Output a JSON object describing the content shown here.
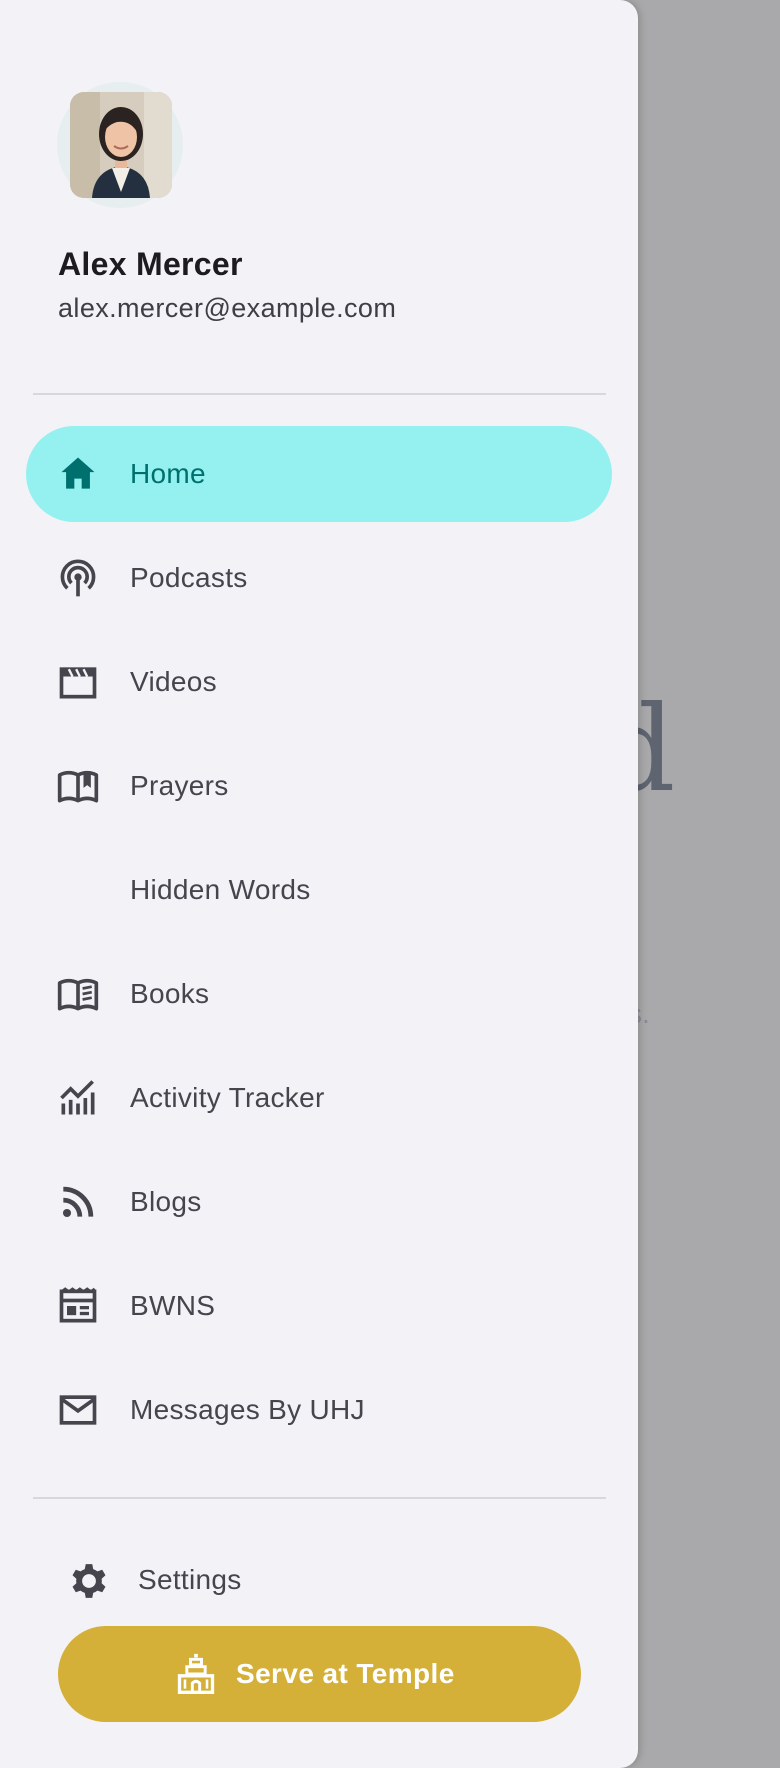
{
  "background": {
    "peek_text": "d",
    "peek_small": "s."
  },
  "profile": {
    "name": "Alex Mercer",
    "email": "alex.mercer@example.com",
    "avatar": "avatar-photo"
  },
  "nav": {
    "items": [
      {
        "label": "Home",
        "icon": "home-icon",
        "active": true
      },
      {
        "label": "Podcasts",
        "icon": "podcast-icon",
        "active": false
      },
      {
        "label": "Videos",
        "icon": "movie-icon",
        "active": false
      },
      {
        "label": "Prayers",
        "icon": "open-book-icon",
        "active": false
      },
      {
        "label": "Hidden Words",
        "icon": "",
        "active": false
      },
      {
        "label": "Books",
        "icon": "book-icon",
        "active": false
      },
      {
        "label": "Activity Tracker",
        "icon": "chart-icon",
        "active": false
      },
      {
        "label": "Blogs",
        "icon": "rss-icon",
        "active": false
      },
      {
        "label": "BWNS",
        "icon": "news-icon",
        "active": false
      },
      {
        "label": "Messages By UHJ",
        "icon": "mail-icon",
        "active": false
      }
    ]
  },
  "footer": {
    "settings_label": "Settings",
    "serve_label": "Serve at Temple"
  },
  "colors": {
    "drawer_bg": "#f3f2f7",
    "active_bg": "#94f1f0",
    "active_text": "#00706e",
    "text": "#46444c",
    "cta_bg": "#d4b038",
    "scrim": "#a9a9ab"
  }
}
